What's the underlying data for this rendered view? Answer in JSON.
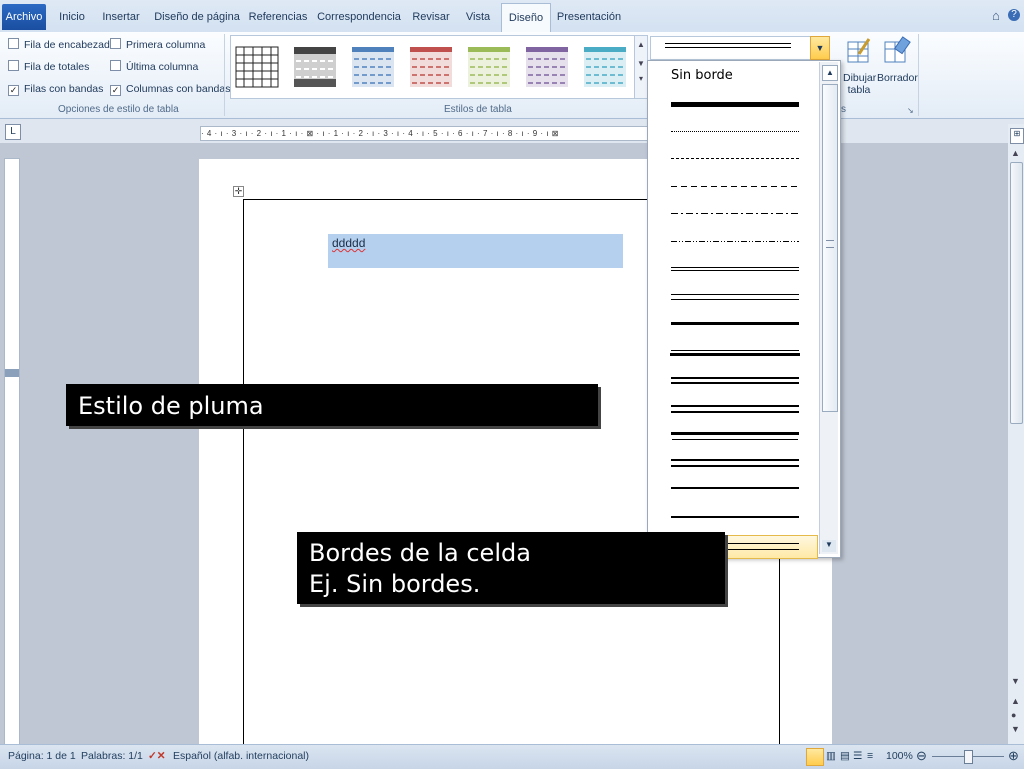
{
  "tabs": [
    "Archivo",
    "Inicio",
    "Insertar",
    "Diseño de página",
    "Referencias",
    "Correspondencia",
    "Revisar",
    "Vista",
    "Diseño",
    "Presentación"
  ],
  "table_options": {
    "fila_encabezado": {
      "label": "Fila de encabezado",
      "checked": false
    },
    "primera_columna": {
      "label": "Primera columna",
      "checked": false
    },
    "fila_totales": {
      "label": "Fila de totales",
      "checked": false
    },
    "ultima_columna": {
      "label": "Última columna",
      "checked": false
    },
    "filas_bandas": {
      "label": "Filas con bandas",
      "checked": true
    },
    "columnas_bandas": {
      "label": "Columnas con bandas",
      "checked": true
    },
    "group_label": "Opciones de estilo de tabla"
  },
  "styles": {
    "group_label": "Estilos de tabla",
    "colors": [
      "#444444",
      "#5a5a5a",
      "#4f81bd",
      "#c0504d",
      "#9bbb59",
      "#8064a2",
      "#4bacc6"
    ]
  },
  "draw": {
    "draw_table_label_1": "Dibujar",
    "draw_table_label_2": "tabla",
    "eraser_label": "Borrador",
    "group_tail": "s"
  },
  "pen_style_menu": {
    "no_border_label": "Sin borde"
  },
  "ruler": {
    "text": "· 4 · ı · 3 · ı · 2 · ı · 1 · ı · ⊠ · ı · 1 · ı · 2 · ı · 3 · ı · 4 · ı · 5 · ı · 6 · ı · 7 · ı · 8 · ı · 9 · ı ⊠"
  },
  "document": {
    "cell_text": "ddddd"
  },
  "callouts": {
    "pen_style": "Estilo de pluma",
    "cell_borders_1": "Bordes de la celda",
    "cell_borders_2": "Ej. Sin bordes."
  },
  "status": {
    "page": "Página: 1 de 1",
    "words": "Palabras: 1/1",
    "language": "Español (alfab. internacional)",
    "zoom": "100%"
  }
}
